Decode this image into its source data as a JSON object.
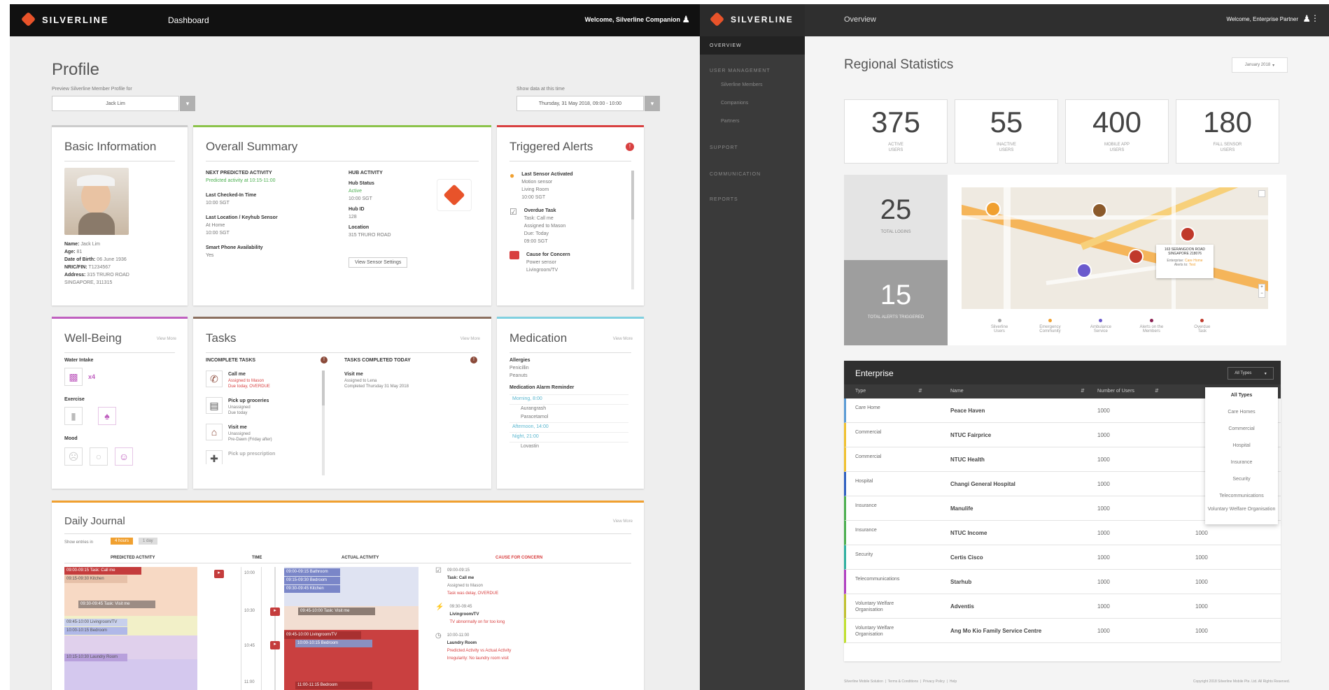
{
  "left": {
    "brand": "SILVERLINE",
    "nav_title": "Dashboard",
    "welcome": "Welcome, Silverline Companion",
    "page_title": "Profile",
    "member_select_label": "Preview Silverline Member Profile for",
    "member_select_value": "Jack Lim",
    "date_label": "Show data at this time",
    "date_value": "Thursday, 31 May 2018, 09:00 - 10:00",
    "basic_info": {
      "title": "Basic Information",
      "fields": [
        {
          "k": "Name:",
          "v": "Jack Lim"
        },
        {
          "k": "Age:",
          "v": "81"
        },
        {
          "k": "Date of Birth:",
          "v": "06 June 1936"
        },
        {
          "k": "NRIC/FIN:",
          "v": "T1234567"
        },
        {
          "k": "Address:",
          "v": "315 TRURO ROAD"
        },
        {
          "k": "",
          "v": "SINGAPORE, 311315"
        }
      ]
    },
    "overall": {
      "title": "Overall Summary",
      "next_activity_h": "NEXT PREDICTED ACTIVITY",
      "next_activity_v": "Predicted activity at 10:15-11:00",
      "last_checked_h": "Last Checked-In Time",
      "last_checked_v": "10:00 SGT",
      "last_location_h": "Last Location / Keyhub Sensor",
      "last_location_v": "At Home",
      "last_location_t": "10:00 SGT",
      "smartphone_h": "Smart Phone Availability",
      "smartphone_v": "Yes",
      "hub_h": "HUB ACTIVITY",
      "hub_status_h": "Hub Status",
      "hub_status_v": "Active",
      "hub_status_t": "10:00 SGT",
      "hub_id_h": "Hub ID",
      "hub_id_v": "128",
      "location_h": "Location",
      "location_v": "315 TRURO ROAD",
      "sensor_btn": "View Sensor Settings"
    },
    "alerts": {
      "title": "Triggered Alerts",
      "items": [
        {
          "t": "Last Sensor Activated",
          "d": "Motion sensor",
          "d2": "Living Room",
          "d3": "10:00 SGT"
        },
        {
          "t": "Overdue Task",
          "d": "Task: Call me",
          "d2": "Assigned to Mason",
          "d3": "Due: Today",
          "d4": "09:00 SGT"
        },
        {
          "t": "Cause for Concern",
          "d": "Power sensor",
          "d2": "Livingroom/TV"
        }
      ]
    },
    "wellbeing": {
      "title": "Well-Being",
      "more": "View More",
      "water_h": "Water Intake",
      "water_v": "x4",
      "exercise_h": "Exercise",
      "mood_h": "Mood"
    },
    "tasks": {
      "title": "Tasks",
      "more": "View More",
      "incomplete_h": "INCOMPLETE TASKS",
      "completed_h": "TASKS COMPLETED TODAY",
      "items": [
        {
          "t": "Call me",
          "d": "Assigned to Mason",
          "d2": "Due today, OVERDUE"
        },
        {
          "t": "Pick up groceries",
          "d": "Unassigned",
          "d2": "Due today"
        },
        {
          "t": "Visit me",
          "d": "Unassigned",
          "d2": "Pre-Dawn (Friday after)"
        },
        {
          "t": "Pick up prescription",
          "d": "",
          "d2": ""
        }
      ],
      "done": [
        {
          "t": "Visit me",
          "d": "Assigned to Lena",
          "d2": "Completed Thursday 31 May 2018"
        }
      ]
    },
    "medication": {
      "title": "Medication",
      "more": "View More",
      "allergies_h": "Allergies",
      "allergies": [
        "Penicillin",
        "Peanuts"
      ],
      "reminder_h": "Medication Alarm Reminder",
      "rows": [
        "Morning, 8:00",
        "Aurangrash",
        "Paracetamol",
        "Afternoon, 14:00",
        "Night, 21:00",
        "Lovastin"
      ]
    },
    "journal": {
      "title": "Daily Journal",
      "more": "View More",
      "filter_label": "Show entries in",
      "filter_a": "4 hours",
      "filter_b": "1 day",
      "col_pred": "PREDICTED ACTIVITY",
      "col_time": "TIME",
      "col_actual": "ACTUAL ACTIVITY",
      "col_cause": "CAUSE FOR CONCERN",
      "times": [
        "10:00",
        "10:30",
        "10:45",
        "11:00"
      ],
      "pred_bars": [
        "09:00-09:15 Task: Call me",
        "09:15-09:30 Kitchen",
        "09:30-09:45 Task: Visit me",
        "09:45-10:00 Livingroom/TV",
        "10:00-10:15 Bedroom",
        "10:15-10:30 Laundry Room"
      ],
      "act_bars": [
        "09:00-09:15 Bathroom",
        "09:15-09:30 Bedroom",
        "09:30-09:45 Kitchen",
        "09:45-10:00 Task: Visit me",
        "09:45-10:00 Livingroom/TV",
        "10:00-10:15 Bedroom",
        "11:00-11:15 Bedroom"
      ],
      "concerns": [
        {
          "time": "09:00-09:15",
          "t": "Task: Call me",
          "d": "Assigned to Mason",
          "r": "Task was delay, OVERDUE"
        },
        {
          "time": "09:30-09:45",
          "t": "Livingroom/TV",
          "r": "TV abnormally on for too long"
        },
        {
          "time": "10:00-11:00",
          "t": "Laundry Room",
          "r": "Predicted Activity vs Actual Activity",
          "r2": "Irregularity: No laundry room visit"
        }
      ]
    }
  },
  "right": {
    "brand": "SILVERLINE",
    "nav_title": "Overview",
    "welcome": "Welcome, Enterprise Partner",
    "side": [
      {
        "label": "OVERVIEW",
        "active": true
      },
      {
        "label": "USER MANAGEMENT",
        "active": false
      },
      {
        "label": "Silverline Members",
        "active": false,
        "sub": true
      },
      {
        "label": "Companions",
        "active": false,
        "sub": true
      },
      {
        "label": "Partners",
        "active": false,
        "sub": true
      },
      {
        "label": "SUPPORT",
        "active": false
      },
      {
        "label": "COMMUNICATION",
        "active": false
      },
      {
        "label": "REPORTS",
        "active": false
      }
    ],
    "page_title": "Regional Statistics",
    "period": "January 2018",
    "stats": [
      {
        "num": "375",
        "l1": "ACTIVE",
        "l2": "USERS"
      },
      {
        "num": "55",
        "l1": "INACTIVE",
        "l2": "USERS"
      },
      {
        "num": "400",
        "l1": "MOBILE APP",
        "l2": "USERS"
      },
      {
        "num": "180",
        "l1": "FALL SENSOR",
        "l2": "USERS"
      }
    ],
    "stat_25": "25",
    "stat_25_l": "TOTAL LOGINS",
    "stat_15": "15",
    "stat_15_l": "TOTAL ALERTS TRIGGERED",
    "map_popup": {
      "t": "163 SERANGOON ROAD",
      "t2": "SINGAPORE 218076",
      "l1": "Enterprise:",
      "v1": "Care Home",
      "l2": "Alerts to:",
      "v2": "Test"
    },
    "legend": [
      {
        "label": "Silverline Users",
        "color": "#aaaaaa"
      },
      {
        "label": "Emergency Community",
        "color": "#f0a030"
      },
      {
        "label": "Ambulance Service",
        "color": "#6a5acd"
      },
      {
        "label": "Alerts on the Members",
        "color": "#8b2252"
      },
      {
        "label": "Overdue Task",
        "color": "#c0392b"
      }
    ],
    "table": {
      "title": "Enterprise",
      "filter": "All Types",
      "cols": [
        "Type",
        "Name",
        "Number of Users"
      ],
      "rows": [
        {
          "type": "Care Home",
          "name": "Peace Haven",
          "n": "1000",
          "n2": "",
          "color": "#5b9bd5"
        },
        {
          "type": "Commercial",
          "name": "NTUC Fairprice",
          "n": "1000",
          "n2": "",
          "color": "#f0c030"
        },
        {
          "type": "Commercial",
          "name": "NTUC Health",
          "n": "1000",
          "n2": "",
          "color": "#f0c030"
        },
        {
          "type": "Hospital",
          "name": "Changi General Hospital",
          "n": "1000",
          "n2": "",
          "color": "#3060c0"
        },
        {
          "type": "Insurance",
          "name": "Manulife",
          "n": "1000",
          "n2": "",
          "color": "#4caf50"
        },
        {
          "type": "Insurance",
          "name": "NTUC Income",
          "n": "1000",
          "n2": "1000",
          "color": "#4caf50"
        },
        {
          "type": "Security",
          "name": "Certis Cisco",
          "n": "1000",
          "n2": "1000",
          "color": "#30b0a0"
        },
        {
          "type": "Telecommunications",
          "name": "Starhub",
          "n": "1000",
          "n2": "1000",
          "color": "#b040c0"
        },
        {
          "type": "Voluntary Welfare Organisation",
          "name": "Adventis",
          "n": "1000",
          "n2": "1000",
          "color": "#c0c030"
        },
        {
          "type": "Voluntary Welfare Organisation",
          "name": "Ang Mo Kio Family Service Centre",
          "n": "1000",
          "n2": "1000",
          "color": "#c0e030"
        }
      ],
      "dropdown": [
        "All Types",
        "Care Homes",
        "Commercial",
        "Hospital",
        "Insurance",
        "Security",
        "Telecommunications",
        "Voluntary Welfare Organisation"
      ]
    },
    "footer_links": [
      "Silverline Mobile Solution",
      "Terms & Conditions",
      "Privacy Policy",
      "Help"
    ],
    "copyright": "Copyright 2018 Silverline Mobile Pte. Ltd. All Rights Reserved."
  }
}
